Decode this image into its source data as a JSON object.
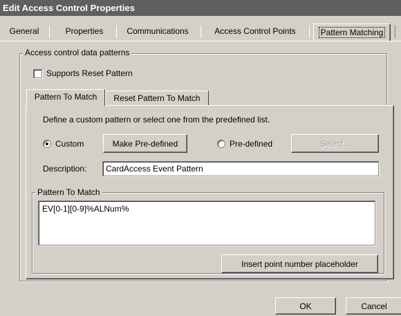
{
  "window": {
    "title": "Edit Access Control Properties"
  },
  "tabs": [
    {
      "label": "General"
    },
    {
      "label": "Properties"
    },
    {
      "label": "Communications"
    },
    {
      "label": "Access Control Points"
    },
    {
      "label": "Pattern Matching"
    }
  ],
  "group": {
    "legend": "Access control data patterns",
    "supports_reset_label": "Supports Reset Pattern",
    "supports_reset_checked": false
  },
  "inner_tabs": [
    {
      "label": "Pattern To Match"
    },
    {
      "label": "Reset Pattern To Match"
    }
  ],
  "panel": {
    "instruction": "Define a custom pattern or select one from the predefined list.",
    "custom_label": "Custom",
    "custom_selected": true,
    "make_predefined_label": "Make Pre-defined",
    "predefined_label": "Pre-defined",
    "select_label": "Select...",
    "description_label": "Description:",
    "description_value": "CardAccess Event Pattern",
    "pattern_group_legend": "Pattern To Match",
    "pattern_value": "EV[0-1][0-9]%ALNum%",
    "insert_placeholder_label": "Insert point number placeholder"
  },
  "footer": {
    "ok_label": "OK",
    "cancel_label": "Cancel"
  }
}
